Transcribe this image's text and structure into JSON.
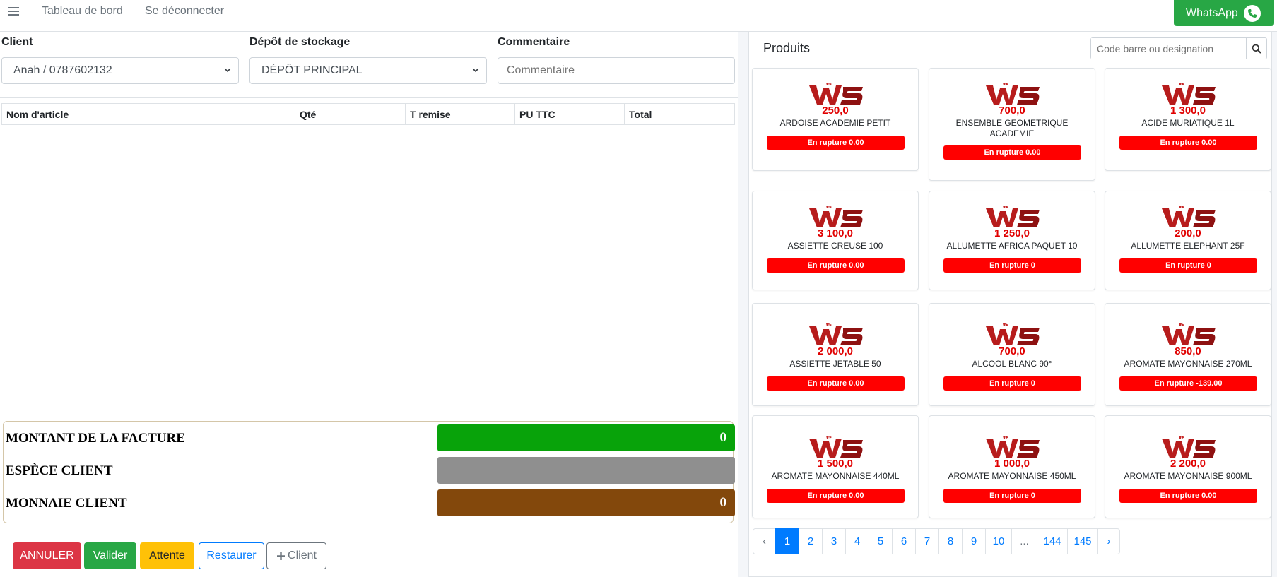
{
  "navbar": {
    "menu_icon": "hamburger-icon",
    "dashboard": "Tableau de bord",
    "logout": "Se déconnecter",
    "whatsapp": "WhatsApp",
    "whatsapp_icon": "whatsapp-phone-icon"
  },
  "form": {
    "client_label": "Client",
    "client_value": "Anah / 0787602132",
    "depot_label": "Dépôt de stockage",
    "depot_value": "DÉPÔT PRINCIPAL",
    "comment_label": "Commentaire",
    "comment_placeholder": "Commentaire"
  },
  "table": {
    "headers": [
      "Nom d'article",
      "Qté",
      "T remise",
      "PU TTC",
      "Total"
    ]
  },
  "totals": {
    "montant_label": "MONTANT DE LA FACTURE",
    "montant_value": "0",
    "espece_label": "ESPÈCE CLIENT",
    "espece_value": "",
    "monnaie_label": "MONNAIE CLIENT",
    "monnaie_value": "0"
  },
  "actions": {
    "annuler": "ANNULER",
    "valider": "Valider",
    "attente": "Attente",
    "restaurer": "Restaurer",
    "client": "Client",
    "client_icon": "plus-icon"
  },
  "products": {
    "title": "Produits",
    "search_placeholder": "Code barre ou designation",
    "search_icon": "search-icon",
    "items": [
      {
        "price": "250,0",
        "name": "ARDOISE ACADEMIE PETIT",
        "stock": "En rupture 0.00"
      },
      {
        "price": "700,0",
        "name": "ENSEMBLE GEOMETRIQUE ACADEMIE",
        "stock": "En rupture 0.00"
      },
      {
        "price": "1 300,0",
        "name": "ACIDE MURIATIQUE 1L",
        "stock": "En rupture 0.00"
      },
      {
        "price": "3 100,0",
        "name": "ASSIETTE CREUSE 100",
        "stock": "En rupture 0.00"
      },
      {
        "price": "1 250,0",
        "name": "ALLUMETTE AFRICA PAQUET 10",
        "stock": "En rupture 0"
      },
      {
        "price": "200,0",
        "name": "ALLUMETTE ELEPHANT 25F",
        "stock": "En rupture 0"
      },
      {
        "price": "2 000,0",
        "name": "ASSIETTE JETABLE 50",
        "stock": "En rupture 0.00"
      },
      {
        "price": "700,0",
        "name": "ALCOOL BLANC 90°",
        "stock": "En rupture 0"
      },
      {
        "price": "850,0",
        "name": "AROMATE MAYONNAISE 270ML",
        "stock": "En rupture -139.00"
      },
      {
        "price": "1 500,0",
        "name": "AROMATE MAYONNAISE 440ML",
        "stock": "En rupture 0.00"
      },
      {
        "price": "1 000,0",
        "name": "AROMATE MAYONNAISE 450ML",
        "stock": "En rupture 0"
      },
      {
        "price": "2 200,0",
        "name": "AROMATE MAYONNAISE 900ML",
        "stock": "En rupture 0.00"
      }
    ],
    "logo_text": "WS"
  },
  "pagination": {
    "prev": "‹",
    "pages": [
      "1",
      "2",
      "3",
      "4",
      "5",
      "6",
      "7",
      "8",
      "9",
      "10",
      "...",
      "144",
      "145"
    ],
    "next": "›",
    "active": "1"
  },
  "colors": {
    "montant_bg": "#08a30a",
    "espece_bg": "#8f8f8f",
    "monnaie_bg": "#83480c",
    "stock_badge": "#ff0000",
    "price_text": "#e00000"
  }
}
